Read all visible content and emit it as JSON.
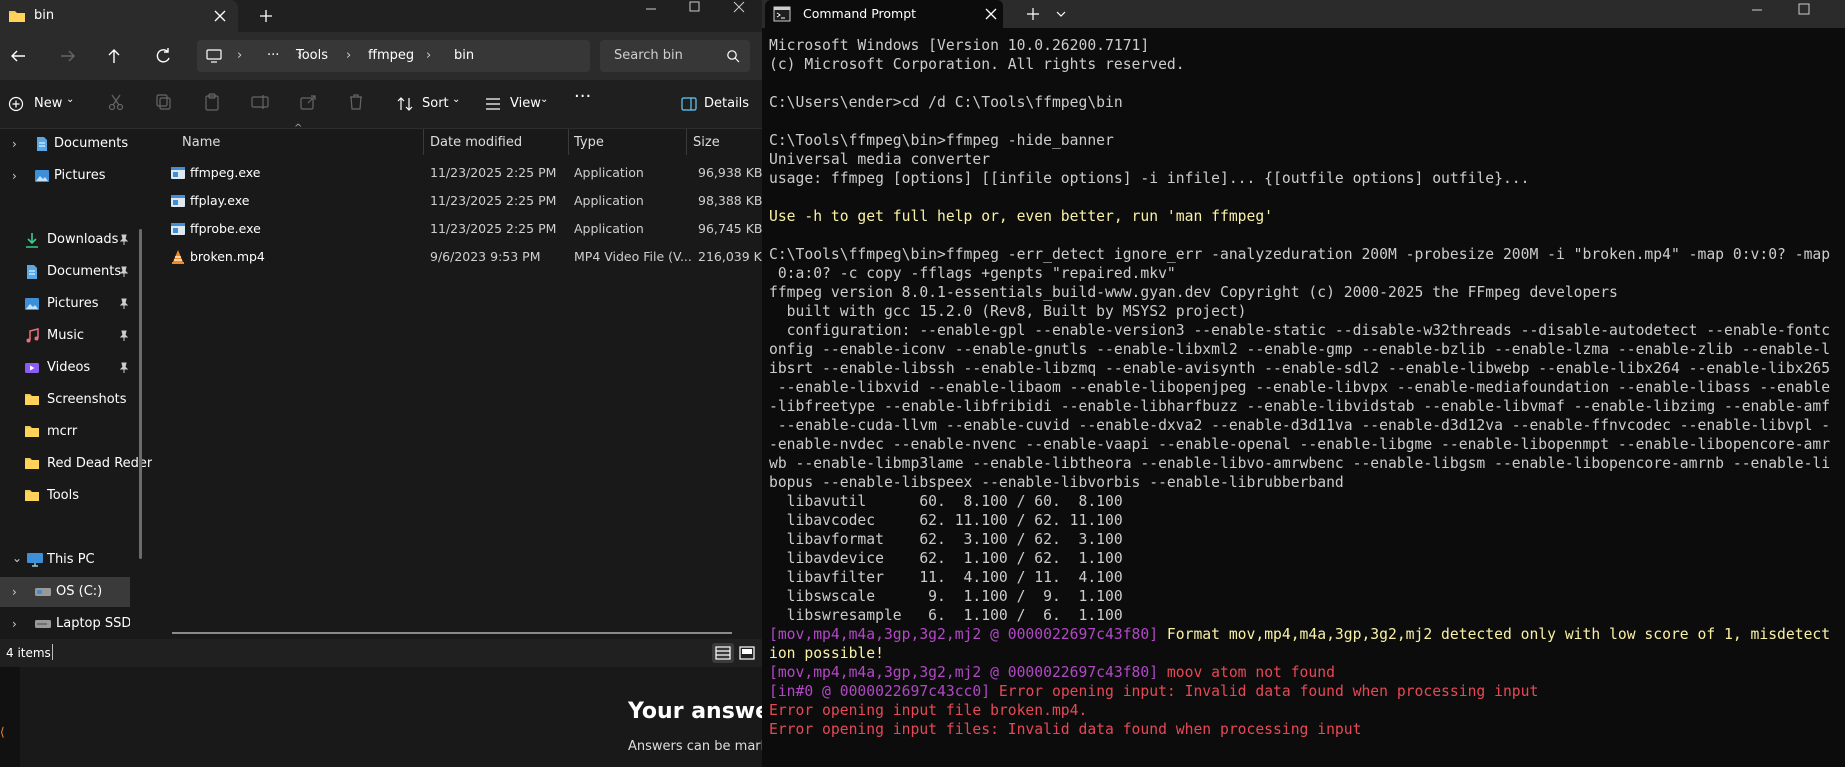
{
  "explorer": {
    "tab_title": "bin",
    "address": {
      "ellipsis": "···",
      "segments": [
        "Tools",
        "ffmpeg",
        "bin"
      ]
    },
    "search_placeholder": "Search bin",
    "toolbar": {
      "new_label": "New",
      "sort_label": "Sort",
      "view_label": "View",
      "details_label": "Details"
    },
    "sidebar": {
      "items": [
        {
          "label": "Documents",
          "icon": "documents-icon"
        },
        {
          "label": "Pictures",
          "icon": "pictures-icon"
        },
        {
          "label": "Downloads",
          "icon": "downloads-icon"
        },
        {
          "label": "Documents",
          "icon": "documents-icon"
        },
        {
          "label": "Pictures",
          "icon": "pictures-icon"
        },
        {
          "label": "Music",
          "icon": "music-icon"
        },
        {
          "label": "Videos",
          "icon": "videos-icon"
        },
        {
          "label": "Screenshots",
          "icon": "folder-icon"
        },
        {
          "label": "mcrr",
          "icon": "folder-icon"
        },
        {
          "label": "Red Dead Reder",
          "icon": "folder-icon"
        },
        {
          "label": "Tools",
          "icon": "folder-icon"
        },
        {
          "label": "This PC",
          "icon": "this-pc-icon"
        },
        {
          "label": "OS (C:)",
          "icon": "drive-icon"
        },
        {
          "label": "Laptop SSD (D",
          "icon": "drive-icon"
        }
      ]
    },
    "columns": [
      "Name",
      "Date modified",
      "Type",
      "Size"
    ],
    "files": [
      {
        "name": "ffmpeg.exe",
        "date": "11/23/2025 2:25 PM",
        "type": "Application",
        "size": "96,938 KB"
      },
      {
        "name": "ffplay.exe",
        "date": "11/23/2025 2:25 PM",
        "type": "Application",
        "size": "98,388 KB"
      },
      {
        "name": "ffprobe.exe",
        "date": "11/23/2025 2:25 PM",
        "type": "Application",
        "size": "96,745 KB"
      },
      {
        "name": "broken.mp4",
        "date": "9/6/2023 9:53 PM",
        "type": "MP4 Video File (V...",
        "size": "216,039 KB"
      }
    ],
    "status_count": "4 items"
  },
  "background_page": {
    "heading": "Your answer",
    "subtext": "Answers can be mark"
  },
  "cmd": {
    "tab_title": "Command Prompt",
    "lines": [
      {
        "text": "Microsoft Windows [Version 10.0.26200.7171]",
        "color": "default"
      },
      {
        "text": "(c) Microsoft Corporation. All rights reserved.",
        "color": "default"
      },
      {
        "text": "",
        "color": "default"
      },
      {
        "text": "C:\\Users\\ender>cd /d C:\\Tools\\ffmpeg\\bin",
        "color": "default"
      },
      {
        "text": "",
        "color": "default"
      },
      {
        "text": "C:\\Tools\\ffmpeg\\bin>ffmpeg -hide_banner",
        "color": "default"
      },
      {
        "text": "Universal media converter",
        "color": "default"
      },
      {
        "text": "usage: ffmpeg [options] [[infile options] -i infile]... {[outfile options] outfile}...",
        "color": "default"
      },
      {
        "text": "",
        "color": "default"
      },
      {
        "text": "Use -h to get full help or, even better, run 'man ffmpeg'",
        "color": "yellow"
      },
      {
        "text": "",
        "color": "default"
      },
      {
        "text": "C:\\Tools\\ffmpeg\\bin>ffmpeg -err_detect ignore_err -analyzeduration 200M -probesize 200M -i \"broken.mp4\" -map 0:v:0? -map",
        "color": "default"
      },
      {
        "text": " 0:a:0? -c copy -fflags +genpts \"repaired.mkv\"",
        "color": "default"
      },
      {
        "text": "ffmpeg version 8.0.1-essentials_build-www.gyan.dev Copyright (c) 2000-2025 the FFmpeg developers",
        "color": "default"
      },
      {
        "text": "  built with gcc 15.2.0 (Rev8, Built by MSYS2 project)",
        "color": "default"
      },
      {
        "text": "  configuration: --enable-gpl --enable-version3 --enable-static --disable-w32threads --disable-autodetect --enable-fontc",
        "color": "default"
      },
      {
        "text": "onfig --enable-iconv --enable-gnutls --enable-libxml2 --enable-gmp --enable-bzlib --enable-lzma --enable-zlib --enable-l",
        "color": "default"
      },
      {
        "text": "ibsrt --enable-libssh --enable-libzmq --enable-avisynth --enable-sdl2 --enable-libwebp --enable-libx264 --enable-libx265",
        "color": "default"
      },
      {
        "text": " --enable-libxvid --enable-libaom --enable-libopenjpeg --enable-libvpx --enable-mediafoundation --enable-libass --enable",
        "color": "default"
      },
      {
        "text": "-libfreetype --enable-libfribidi --enable-libharfbuzz --enable-libvidstab --enable-libvmaf --enable-libzimg --enable-amf",
        "color": "default"
      },
      {
        "text": " --enable-cuda-llvm --enable-cuvid --enable-dxva2 --enable-d3d11va --enable-d3d12va --enable-ffnvcodec --enable-libvpl -",
        "color": "default"
      },
      {
        "text": "-enable-nvdec --enable-nvenc --enable-vaapi --enable-openal --enable-libgme --enable-libopenmpt --enable-libopencore-amr",
        "color": "default"
      },
      {
        "text": "wb --enable-libmp3lame --enable-libtheora --enable-libvo-amrwbenc --enable-libgsm --enable-libopencore-amrnb --enable-li",
        "color": "default"
      },
      {
        "text": "bopus --enable-libspeex --enable-libvorbis --enable-librubberband",
        "color": "default"
      },
      {
        "text": "  libavutil      60.  8.100 / 60.  8.100",
        "color": "default"
      },
      {
        "text": "  libavcodec     62. 11.100 / 62. 11.100",
        "color": "default"
      },
      {
        "text": "  libavformat    62.  3.100 / 62.  3.100",
        "color": "default"
      },
      {
        "text": "  libavdevice    62.  1.100 / 62.  1.100",
        "color": "default"
      },
      {
        "text": "  libavfilter    11.  4.100 / 11.  4.100",
        "color": "default"
      },
      {
        "text": "  libswscale      9.  1.100 /  9.  1.100",
        "color": "default"
      },
      {
        "text": "  libswresample   6.  1.100 /  6.  1.100",
        "color": "default"
      }
    ],
    "warn1_tag": "[mov,mp4,m4a,3gp,3g2,mj2 @ 0000022697c43f80]",
    "warn1_msg": " Format mov,mp4,m4a,3gp,3g2,mj2 detected only with low score of 1, misdetect",
    "warn1_cont": "ion possible!",
    "err1_tag": "[mov,mp4,m4a,3gp,3g2,mj2 @ 0000022697c43f80]",
    "err1_msg": " moov atom not found",
    "err2_tag": "[in#0 @ 0000022697c43cc0]",
    "err2_msg": " Error opening input: Invalid data found when processing input",
    "err3": "Error opening input file broken.mp4.",
    "err4": "Error opening input files: Invalid data found when processing input"
  },
  "colors": {
    "terminal_bg": "#0c0c0c",
    "terminal_fg": "#cccccc",
    "warning_yellow": "#f9f1a5",
    "tag_magenta": "#b148c6",
    "error_red": "#e74856",
    "accent_blue": "#60cdff"
  }
}
